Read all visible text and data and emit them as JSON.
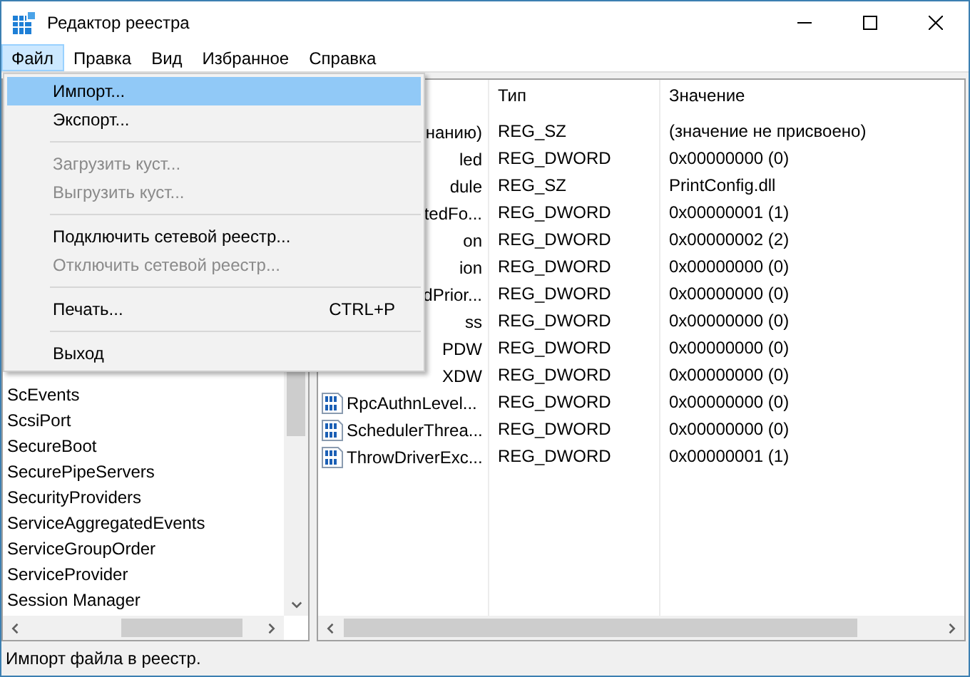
{
  "window": {
    "title": "Редактор реестра"
  },
  "menu_bar": [
    {
      "label": "Файл",
      "selected": true
    },
    {
      "label": "Правка",
      "selected": false
    },
    {
      "label": "Вид",
      "selected": false
    },
    {
      "label": "Избранное",
      "selected": false
    },
    {
      "label": "Справка",
      "selected": false
    }
  ],
  "file_menu": [
    {
      "kind": "item",
      "label": "Импорт...",
      "selected": true,
      "disabled": false
    },
    {
      "kind": "item",
      "label": "Экспорт...",
      "selected": false,
      "disabled": false
    },
    {
      "kind": "separator"
    },
    {
      "kind": "item",
      "label": "Загрузить куст...",
      "selected": false,
      "disabled": true
    },
    {
      "kind": "item",
      "label": "Выгрузить куст...",
      "selected": false,
      "disabled": true
    },
    {
      "kind": "separator"
    },
    {
      "kind": "item",
      "label": "Подключить сетевой реестр...",
      "selected": false,
      "disabled": false
    },
    {
      "kind": "item",
      "label": "Отключить сетевой реестр...",
      "selected": false,
      "disabled": true
    },
    {
      "kind": "separator"
    },
    {
      "kind": "item",
      "label": "Печать...",
      "shortcut": "CTRL+P",
      "selected": false,
      "disabled": false
    },
    {
      "kind": "separator"
    },
    {
      "kind": "item",
      "label": "Выход",
      "selected": false,
      "disabled": false
    }
  ],
  "tree": {
    "items": [
      "ScEvents",
      "ScsiPort",
      "SecureBoot",
      "SecurePipeServers",
      "SecurityProviders",
      "ServiceAggregatedEvents",
      "ServiceGroupOrder",
      "ServiceProvider",
      "Session Manager"
    ]
  },
  "table": {
    "columns": [
      "Тип",
      "Значение"
    ],
    "rows": [
      {
        "kind": "partial",
        "name": "нанию)",
        "type": "REG_SZ",
        "value": "(значение не присвоено)"
      },
      {
        "kind": "partial",
        "name": "led",
        "type": "REG_DWORD",
        "value": "0x00000000 (0)"
      },
      {
        "kind": "partial",
        "name": "dule",
        "type": "REG_SZ",
        "value": "PrintConfig.dll"
      },
      {
        "kind": "partial",
        "name": "tedFo...",
        "type": "REG_DWORD",
        "value": "0x00000001 (1)"
      },
      {
        "kind": "partial",
        "name": "on",
        "type": "REG_DWORD",
        "value": "0x00000002 (2)"
      },
      {
        "kind": "partial",
        "name": "ion",
        "type": "REG_DWORD",
        "value": "0x00000000 (0)"
      },
      {
        "kind": "partial",
        "name": "dPrior...",
        "type": "REG_DWORD",
        "value": "0x00000000 (0)"
      },
      {
        "kind": "partial",
        "name": "ss",
        "type": "REG_DWORD",
        "value": "0x00000000 (0)"
      },
      {
        "kind": "partial",
        "name": "PDW",
        "type": "REG_DWORD",
        "value": "0x00000000 (0)"
      },
      {
        "kind": "partial",
        "name": "XDW",
        "type": "REG_DWORD",
        "value": "0x00000000 (0)"
      },
      {
        "kind": "full",
        "name": "RpcAuthnLevel...",
        "type": "REG_DWORD",
        "value": "0x00000000 (0)"
      },
      {
        "kind": "full",
        "name": "SchedulerThrea...",
        "type": "REG_DWORD",
        "value": "0x00000000 (0)"
      },
      {
        "kind": "full",
        "name": "ThrowDriverExc...",
        "type": "REG_DWORD",
        "value": "0x00000001 (1)"
      }
    ]
  },
  "status_bar": "Импорт файла в реестр."
}
